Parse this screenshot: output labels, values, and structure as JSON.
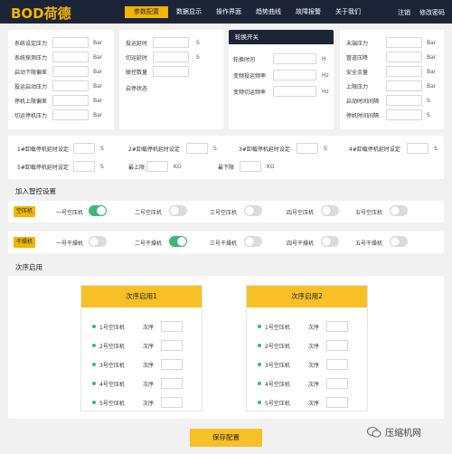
{
  "brand": {
    "logo": "BOD荷德"
  },
  "nav": {
    "items": [
      "参数配置",
      "数据显示",
      "操作界面",
      "趋势曲线",
      "故障报警",
      "关于我们"
    ],
    "active": "参数配置"
  },
  "topright": {
    "logout": "注销",
    "change_password": "修改密码"
  },
  "panel1": {
    "rows": [
      {
        "label": "系统设定压力",
        "unit": "Bar"
      },
      {
        "label": "系统探测压力",
        "unit": "Bar"
      },
      {
        "label": "启动下限偏差",
        "unit": "Bar"
      },
      {
        "label": "投运启动压力",
        "unit": "Bar"
      },
      {
        "label": "停机上限偏差",
        "unit": "Bar"
      },
      {
        "label": "切运停机压力",
        "unit": "Bar"
      }
    ]
  },
  "panel2": {
    "rows": [
      {
        "label": "投运延时",
        "unit": "S"
      },
      {
        "label": "切运延时",
        "unit": "S"
      },
      {
        "label": "联控数量",
        "unit": ""
      },
      {
        "label": "启停状态",
        "unit": ""
      }
    ]
  },
  "panel3": {
    "header": "轮换开关",
    "rows": [
      {
        "label": "轮换时间",
        "unit": "H"
      },
      {
        "label": "变频投运频率",
        "unit": "Hz"
      },
      {
        "label": "变频切运频率",
        "unit": "Hz"
      }
    ]
  },
  "panel4": {
    "rows": [
      {
        "label": "末端压力",
        "unit": "Bar"
      },
      {
        "label": "管道压降",
        "unit": "Bar"
      },
      {
        "label": "安全余量",
        "unit": "Bar"
      },
      {
        "label": "上限压力",
        "unit": "Bar"
      },
      {
        "label": "启动时间间隔",
        "unit": "S"
      },
      {
        "label": "停机时间间隔",
        "unit": "S"
      }
    ]
  },
  "delays": {
    "row1": [
      {
        "label": "1#卸载停机延时设定",
        "unit": "S"
      },
      {
        "label": "2#卸载停机延时设定",
        "unit": "S"
      },
      {
        "label": "3#卸载停机延时设定",
        "unit": "S"
      },
      {
        "label": "4#卸载停机延时设定",
        "unit": "S"
      }
    ],
    "row2": [
      {
        "label": "5#卸载停机延时设定",
        "unit": "S"
      },
      {
        "label": "最上限",
        "unit": "KG"
      },
      {
        "label": "最下限",
        "unit": "KG"
      }
    ]
  },
  "control": {
    "title": "加入智控设置",
    "compressor_tag": "空压机",
    "dryer_tag": "干燥机",
    "compressors": [
      {
        "label": "一号空压机",
        "on": true
      },
      {
        "label": "二号空压机",
        "on": false
      },
      {
        "label": "三号空压机",
        "on": false
      },
      {
        "label": "四号空压机",
        "on": false
      },
      {
        "label": "五号空压机",
        "on": false
      }
    ],
    "dryers": [
      {
        "label": "一号干燥机",
        "on": false
      },
      {
        "label": "二号干燥机",
        "on": true
      },
      {
        "label": "三号干燥机",
        "on": false
      },
      {
        "label": "四号干燥机",
        "on": false
      },
      {
        "label": "五号干燥机",
        "on": false
      }
    ]
  },
  "sequence": {
    "title": "次序启用",
    "cards": [
      {
        "header": "次序启用1",
        "rows": [
          "1号空压机",
          "2号空压机",
          "3号空压机",
          "4号空压机",
          "5号空压机"
        ]
      },
      {
        "header": "次序启用2",
        "rows": [
          "1号空压机",
          "2号空压机",
          "3号空压机",
          "4号空压机",
          "5号空压机"
        ]
      }
    ],
    "order_label": "次序"
  },
  "save": {
    "label": "保存配置"
  },
  "watermark": {
    "text": "压缩机网"
  },
  "colors": {
    "navy": "#1c2438",
    "accent": "#f4b400",
    "toggle_on": "#3cb878"
  }
}
